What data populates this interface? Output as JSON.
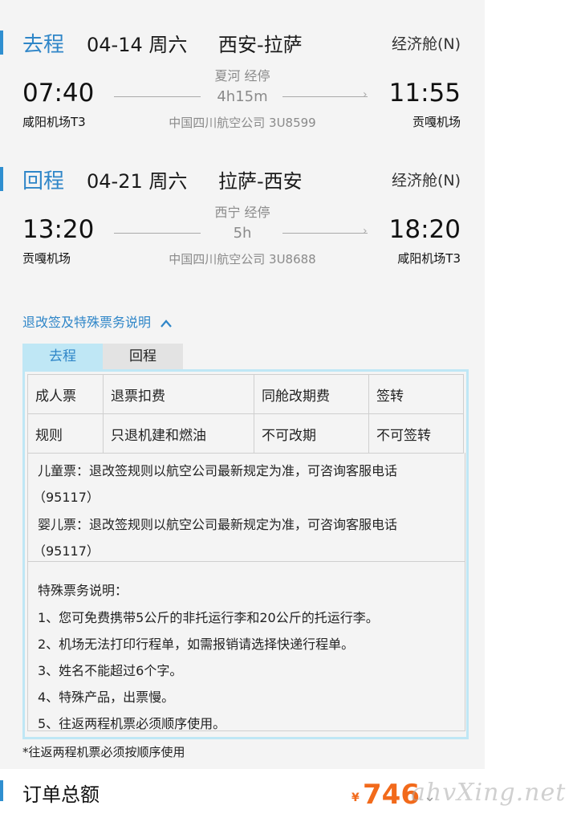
{
  "outbound": {
    "direction": "去程",
    "date": "04-14 周六",
    "route": "西安-拉萨",
    "cabin": "经济舱(N)",
    "stop_note": "夏河 经停",
    "duration": "4h15m",
    "airline_flight": "中国四川航空公司 3U8599",
    "dep_time": "07:40",
    "dep_airport": "咸阳机场T3",
    "arr_time": "11:55",
    "arr_airport": "贡嘎机场"
  },
  "return": {
    "direction": "回程",
    "date": "04-21 周六",
    "route": "拉萨-西安",
    "cabin": "经济舱(N)",
    "stop_note": "西宁 经停",
    "duration": "5h",
    "airline_flight": "中国四川航空公司 3U8688",
    "dep_time": "13:20",
    "dep_airport": "贡嘎机场",
    "arr_time": "18:20",
    "arr_airport": "咸阳机场T3"
  },
  "rules": {
    "toggle_label": "退改签及特殊票务说明",
    "tabs": [
      "去程",
      "回程"
    ],
    "table_header": [
      "成人票",
      "退票扣费",
      "同舱改期费",
      "签转"
    ],
    "table_row": [
      "规则",
      "只退机建和燃油",
      "不可改期",
      "不可签转"
    ],
    "child_line1": "儿童票：退改签规则以航空公司最新规定为准，可咨询客服电话",
    "child_line2": "（95117）",
    "infant_line1": "婴儿票：退改签规则以航空公司最新规定为准，可咨询客服电话",
    "infant_line2": "（95117）",
    "special_title": "特殊票务说明：",
    "special_items": [
      "1、您可免费携带5公斤的非托运行李和20公斤的托运行李。",
      "2、机场无法打印行程单，如需报销请选择快递行程单。",
      "3、姓名不能超过6个字。",
      "4、特殊产品，出票慢。",
      "5、往返两程机票必须顺序使用。"
    ]
  },
  "footnote": "*往返两程机票必须按顺序使用",
  "order_total": {
    "label": "订单总额",
    "currency": "¥",
    "amount": "746"
  },
  "watermark": "ahvXing.net",
  "colors": {
    "accent_blue": "#2f86c8",
    "price_orange": "#f26a1b",
    "tab_active_bg": "#bfe7f5"
  }
}
